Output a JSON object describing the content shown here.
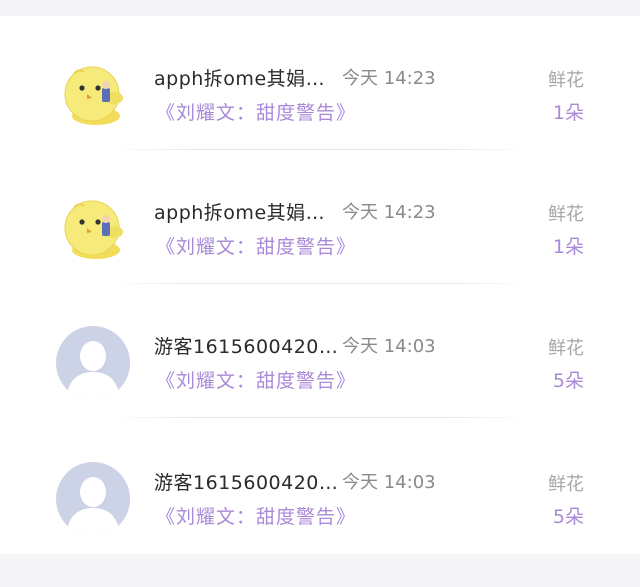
{
  "gifts": [
    {
      "avatar": "yellow-chick-icon",
      "name": "apph拆ome其娟…",
      "time": "今天 14:23",
      "song": "《刘耀文：甜度警告》",
      "gift_label": "鲜花",
      "gift_count": "1朵"
    },
    {
      "avatar": "yellow-chick-icon",
      "name": "apph拆ome其娟…",
      "time": "今天 14:23",
      "song": "《刘耀文：甜度警告》",
      "gift_label": "鲜花",
      "gift_count": "1朵"
    },
    {
      "avatar": "default-user-icon",
      "name": "游客1615600420…",
      "time": "今天 14:03",
      "song": "《刘耀文：甜度警告》",
      "gift_label": "鲜花",
      "gift_count": "5朵"
    },
    {
      "avatar": "default-user-icon",
      "name": "游客1615600420…",
      "time": "今天 14:03",
      "song": "《刘耀文：甜度警告》",
      "gift_label": "鲜花",
      "gift_count": "5朵"
    }
  ],
  "colors": {
    "accent_purple": "#a98ad9",
    "avatar_default_bg": "#cdd3e6",
    "chick_yellow": "#f4e56a"
  }
}
